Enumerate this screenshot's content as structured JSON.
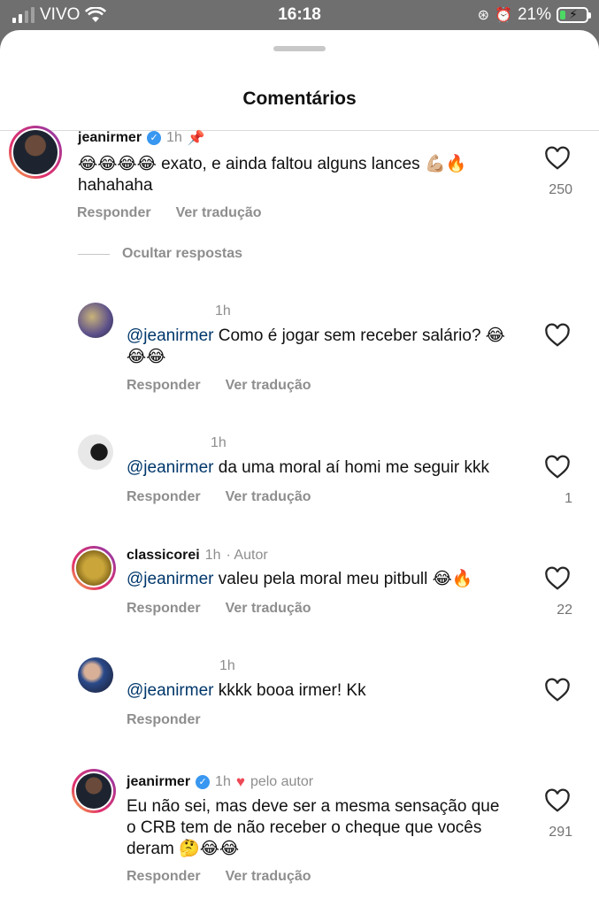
{
  "status": {
    "carrier": "VIVO",
    "time": "16:18",
    "battery": "21%",
    "battery_level": 0.21
  },
  "sheet": {
    "title": "Comentários"
  },
  "hide_replies": "Ocultar respostas",
  "labels": {
    "reply": "Responder",
    "translate": "Ver tradução"
  },
  "comments": [
    {
      "user": "jeanirmer",
      "time": "1h",
      "verified": true,
      "pinned": true,
      "text": "😂😂😂😂 exato, e ainda faltou alguns lances 💪🏼🔥 hahahaha",
      "likes": "250",
      "avatar_icon": "profile-photo"
    },
    {
      "user": "",
      "time": "1h",
      "mention": "@jeanirmer",
      "text": " Como é jogar sem receber salário? 😂😂😂",
      "likes": ""
    },
    {
      "user": "",
      "time": "1h",
      "mention": "@jeanirmer",
      "text": " da uma moral aí homi me seguir kkk",
      "likes": "1"
    },
    {
      "user": "classicorei",
      "time": "1h",
      "badge": "· Autor",
      "mention": "@jeanirmer",
      "text": " valeu pela moral meu pitbull 😂🔥",
      "likes": "22"
    },
    {
      "user": "",
      "time": "1h",
      "mention": "@jeanirmer",
      "text": " kkkk booa irmer! Kk",
      "likes": ""
    },
    {
      "user": "jeanirmer",
      "time": "1h",
      "verified": true,
      "liked_by_author": "pelo autor",
      "text": "Eu não sei, mas deve ser a mesma sensação que o CRB tem de não receber o cheque que vocês deram 🤔😂😂",
      "likes": "291"
    }
  ],
  "colors": {
    "mention": "#00376b",
    "verified": "#3897f0",
    "heart": "#ed4956",
    "battery_fill": "#4cd964"
  }
}
